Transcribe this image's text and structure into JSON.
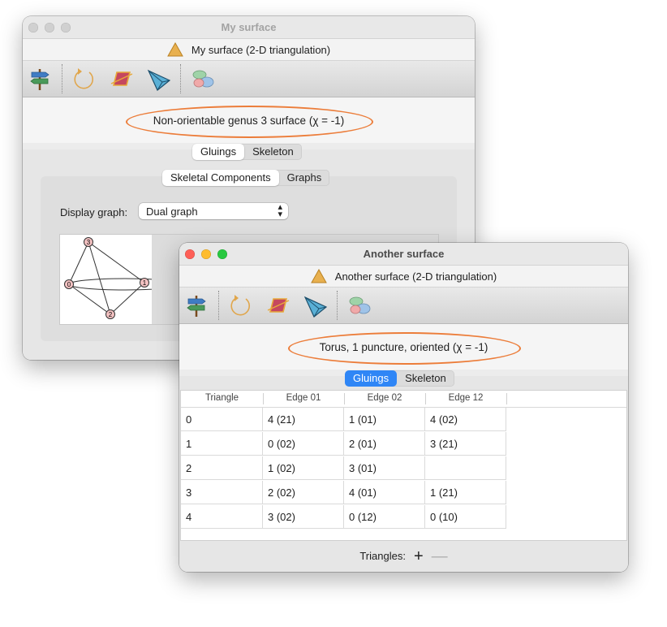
{
  "window1": {
    "title": "My surface",
    "header": "My surface (2-D triangulation)",
    "summary": "Non-orientable genus 3 surface (χ = -1)",
    "tabs": [
      "Gluings",
      "Skeleton"
    ],
    "subtabs": [
      "Skeletal Components",
      "Graphs"
    ],
    "display_graph_label": "Display graph:",
    "display_graph_value": "Dual graph",
    "graph_nodes": [
      "0",
      "1",
      "2",
      "3"
    ]
  },
  "window2": {
    "title": "Another surface",
    "header": "Another surface (2-D triangulation)",
    "summary": "Torus, 1 puncture, oriented (χ = -1)",
    "tabs": [
      "Gluings",
      "Skeleton"
    ],
    "table": {
      "headers": [
        "Triangle",
        "Edge 01",
        "Edge 02",
        "Edge 12"
      ],
      "rows": [
        [
          "0",
          "4 (21)",
          "1 (01)",
          "4 (02)"
        ],
        [
          "1",
          "0 (02)",
          "2 (01)",
          "3 (21)"
        ],
        [
          "2",
          "1 (02)",
          "3 (01)",
          ""
        ],
        [
          "3",
          "2 (02)",
          "4 (01)",
          "1 (21)"
        ],
        [
          "4",
          "3 (02)",
          "0 (12)",
          "0 (10)"
        ]
      ]
    },
    "footer_label": "Triangles:",
    "add_symbol": "+",
    "remove_symbol": "—"
  },
  "colors": {
    "highlight_ellipse": "#ec7d3a",
    "accent": "#2f86f6"
  }
}
